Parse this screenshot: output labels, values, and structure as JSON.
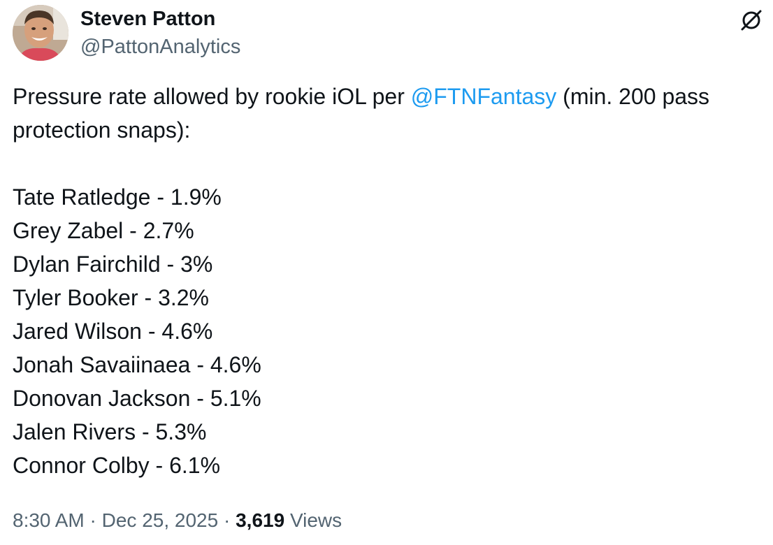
{
  "author": {
    "display_name": "Steven Patton",
    "handle": "@PattonAnalytics"
  },
  "icons": {
    "top_right": "grok-slash-circle-icon",
    "avatar": "profile-photo"
  },
  "tweet": {
    "text_prefix": "Pressure rate allowed by rookie iOL per ",
    "mention": "@FTNFantasy",
    "text_suffix": " (min. 200 pass protection snaps):",
    "list": [
      "Tate Ratledge - 1.9%",
      "Grey Zabel - 2.7%",
      "Dylan Fairchild - 3%",
      "Tyler Booker - 3.2%",
      "Jared Wilson - 4.6%",
      "Jonah Savaiinaea - 4.6%",
      "Donovan Jackson - 5.1%",
      "Jalen Rivers - 5.3%",
      "Connor Colby - 6.1%"
    ]
  },
  "meta": {
    "time": "8:30 AM",
    "separator": " · ",
    "date": "Dec 25, 2025",
    "views_count": "3,619",
    "views_label": "Views"
  },
  "colors": {
    "text": "#0f1419",
    "secondary": "#536471",
    "link": "#1d9bf0"
  }
}
